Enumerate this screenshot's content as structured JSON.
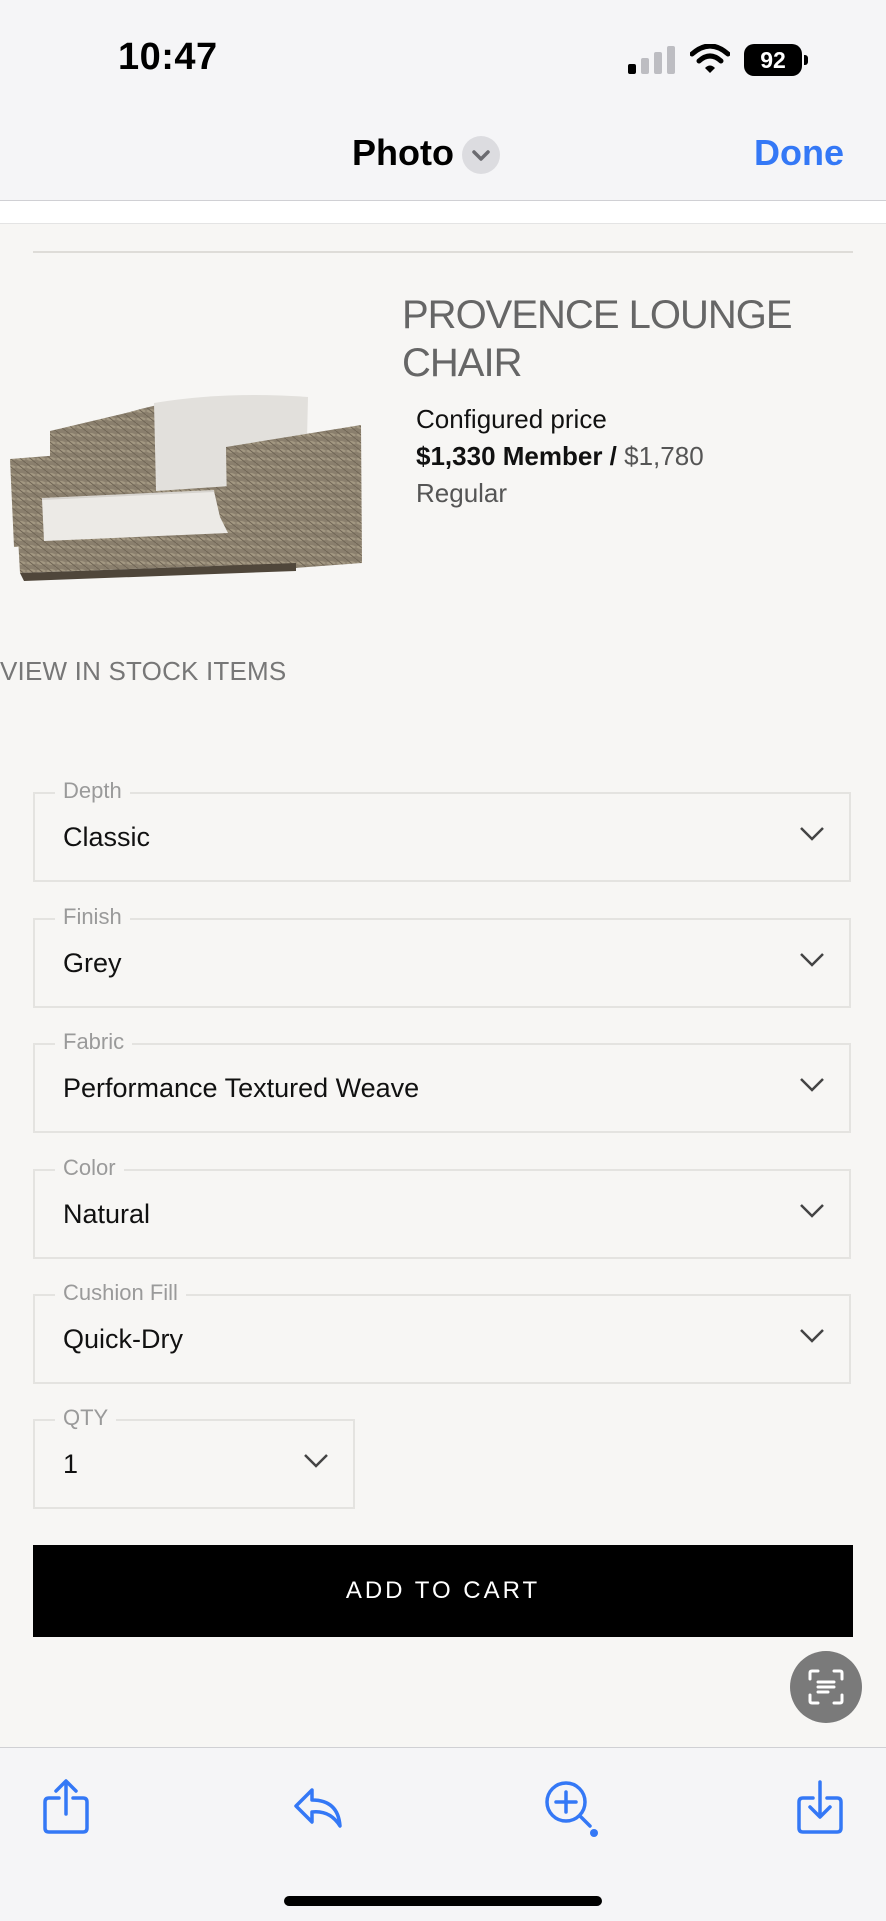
{
  "status_bar": {
    "time": "10:47",
    "battery": "92",
    "icons": [
      "signal-icon",
      "wifi-icon",
      "battery-icon"
    ]
  },
  "nav": {
    "title": "Photo",
    "done_label": "Done",
    "colors": {
      "accent": "#3478f6"
    }
  },
  "product": {
    "title": "PROVENCE LOUNGE CHAIR",
    "price_label": "Configured price",
    "member_price": "$1,330 Member /",
    "regular_price": "$1,780",
    "regular_label": "Regular",
    "stock_link": "VIEW IN STOCK ITEMS"
  },
  "options": [
    {
      "label": "Depth",
      "value": "Classic"
    },
    {
      "label": "Finish",
      "value": "Grey"
    },
    {
      "label": "Fabric",
      "value": "Performance Textured Weave"
    },
    {
      "label": "Color",
      "value": "Natural"
    },
    {
      "label": "Cushion Fill",
      "value": "Quick-Dry"
    }
  ],
  "qty": {
    "label": "QTY",
    "value": "1"
  },
  "cart": {
    "button_label": "ADD TO CART"
  },
  "toolbar": {
    "icons": [
      "share-icon",
      "reply-icon",
      "zoom-in-icon",
      "download-icon"
    ],
    "colors": {
      "icon": "#3478f6"
    }
  }
}
